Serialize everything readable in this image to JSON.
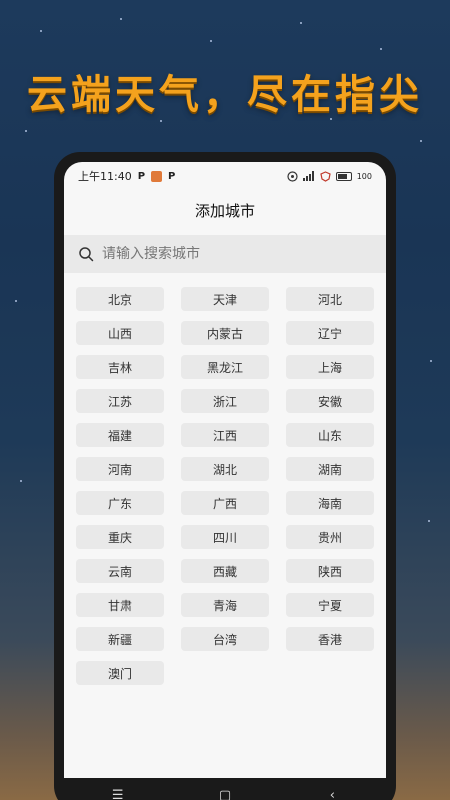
{
  "banner": {
    "headline": "云端天气，尽在指尖"
  },
  "status_bar": {
    "time": "上午11:40",
    "battery": "100"
  },
  "page": {
    "title": "添加城市"
  },
  "search": {
    "placeholder": "请输入搜索城市"
  },
  "cities": [
    "北京",
    "天津",
    "河北",
    "山西",
    "内蒙古",
    "辽宁",
    "吉林",
    "黑龙江",
    "上海",
    "江苏",
    "浙江",
    "安徽",
    "福建",
    "江西",
    "山东",
    "河南",
    "湖北",
    "湖南",
    "广东",
    "广西",
    "海南",
    "重庆",
    "四川",
    "贵州",
    "云南",
    "西藏",
    "陕西",
    "甘肃",
    "青海",
    "宁夏",
    "新疆",
    "台湾",
    "香港",
    "澳门"
  ],
  "nav": {
    "menu": "☰",
    "home": "▢",
    "back": "‹"
  },
  "colors": {
    "headline": "#f4a21d",
    "chip_bg": "#e9e9e9",
    "screen_bg": "#f7f7f7"
  }
}
